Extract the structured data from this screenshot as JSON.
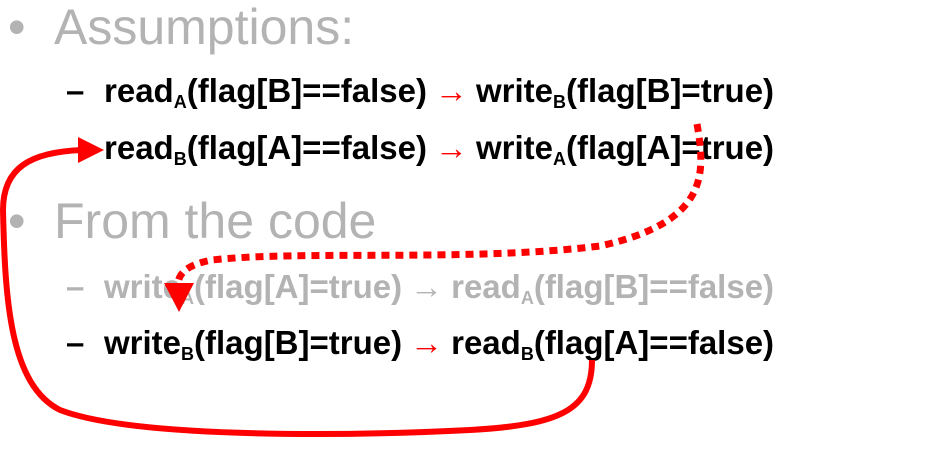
{
  "bullets": [
    {
      "title": "Assumptions:",
      "items": [
        {
          "dash": "–",
          "left": {
            "fn": "read",
            "sub": "A",
            "arg": "(flag[B]==false)"
          },
          "arrow": "→",
          "right": {
            "fn": "write",
            "sub": "B",
            "arg": "(flag[B]=true)"
          }
        },
        {
          "dash": "",
          "left": {
            "fn": "read",
            "sub": "B",
            "arg": "(flag[A]==false)"
          },
          "arrow": "→",
          "right": {
            "fn": "write",
            "sub": "A",
            "arg": "(flag[A]=true)"
          }
        }
      ]
    },
    {
      "title": "From the code",
      "items": [
        {
          "dash": "–",
          "left": {
            "fn": "write",
            "sub": "A",
            "arg": "(flag[A]=true)"
          },
          "arrow": "→",
          "right": {
            "fn": "read",
            "sub": "A",
            "arg": "(flag[B]==false)"
          }
        },
        {
          "dash": "–",
          "left": {
            "fn": "write",
            "sub": "B",
            "arg": "(flag[B]=true)"
          },
          "arrow": "→",
          "right": {
            "fn": "read",
            "sub": "B",
            "arg": "(flag[A]==false)"
          }
        }
      ]
    }
  ],
  "bullet_symbol": "•",
  "colors": {
    "accent": "#ff0000",
    "text": "#000000",
    "dimmed": "#b3b3b3"
  }
}
